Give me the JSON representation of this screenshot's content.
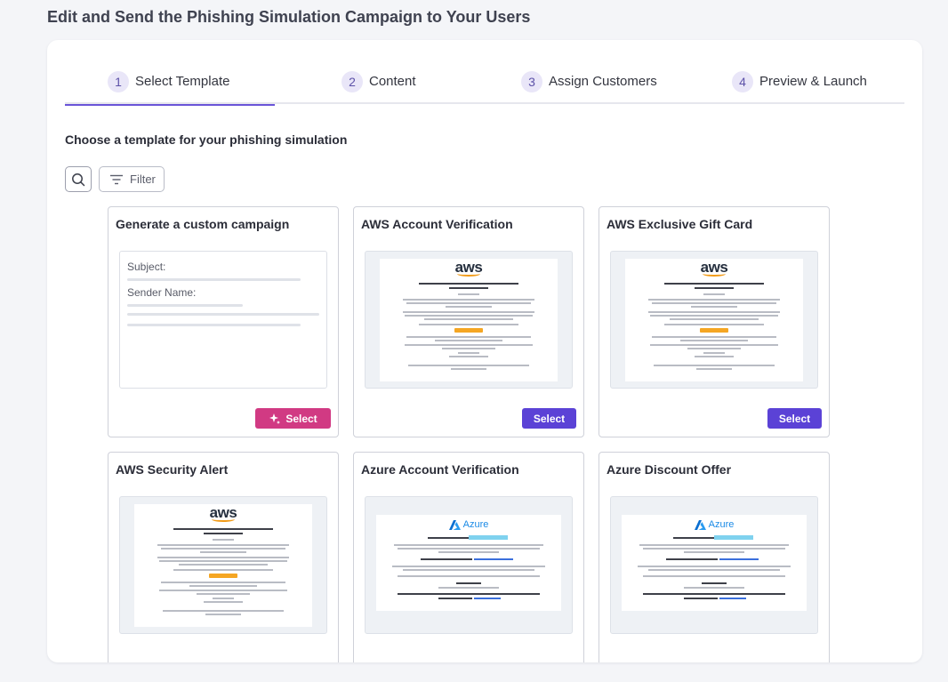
{
  "page": {
    "title": "Edit and Send the Phishing Simulation Campaign to Your Users"
  },
  "steps": [
    {
      "num": "1",
      "label": "Select Template",
      "active": true
    },
    {
      "num": "2",
      "label": "Content",
      "active": false
    },
    {
      "num": "3",
      "label": "Assign Customers",
      "active": false
    },
    {
      "num": "4",
      "label": "Preview & Launch",
      "active": false
    }
  ],
  "section": {
    "title": "Choose a template for your phishing simulation"
  },
  "toolbar": {
    "search_icon": "search-icon",
    "filter_label": "Filter",
    "filter_icon": "filter-icon"
  },
  "cards": [
    {
      "title": "Generate a custom campaign",
      "type": "custom",
      "subject_label": "Subject:",
      "sender_label": "Sender Name:",
      "button": "Select",
      "button_icon": "sparkle-icon"
    },
    {
      "title": "AWS Account Verification",
      "type": "aws",
      "button": "Select"
    },
    {
      "title": "AWS Exclusive Gift Card",
      "type": "aws",
      "button": "Select"
    },
    {
      "title": "AWS Security Alert",
      "type": "aws"
    },
    {
      "title": "Azure Account Verification",
      "type": "azure"
    },
    {
      "title": "Azure Discount Offer",
      "type": "azure"
    }
  ],
  "mock": {
    "aws_logo": "aws",
    "azure_logo": "Azure"
  },
  "colors": {
    "accent": "#5b42d6",
    "custom_select": "#d13a83",
    "step_badge": "#e9e6f8",
    "active_underline": "#6a55d8"
  }
}
